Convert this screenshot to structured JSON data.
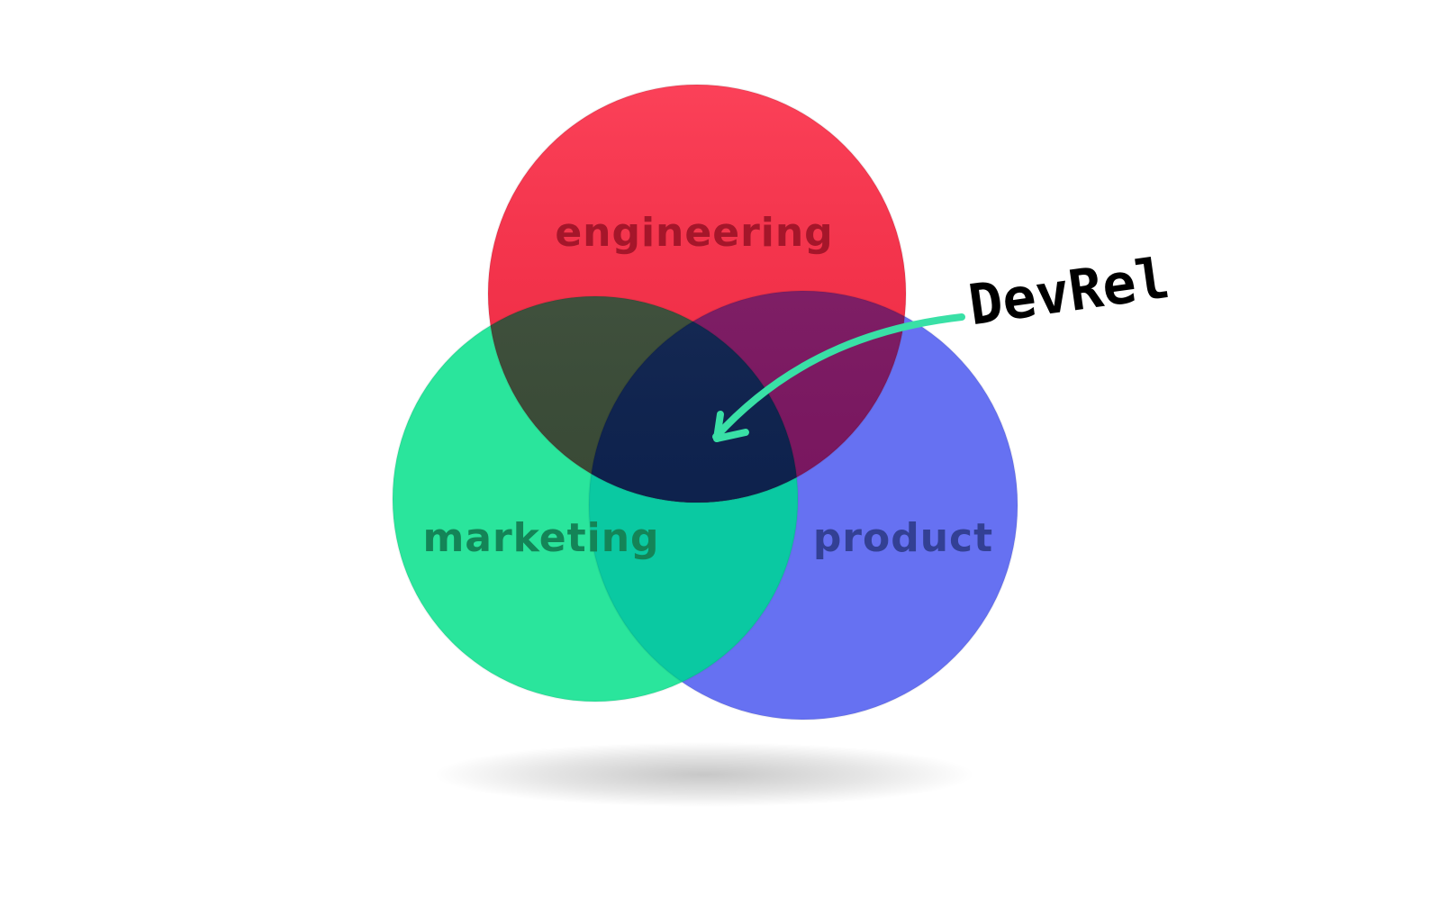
{
  "diagram": {
    "sets": [
      {
        "id": "engineering",
        "label": "engineering",
        "color": "#fb2c46",
        "label_color": "#a5162a"
      },
      {
        "id": "marketing",
        "label": "marketing",
        "color": "#2ae59c",
        "label_color": "#148457"
      },
      {
        "id": "product",
        "label": "product",
        "color": "#6671f2",
        "label_color": "#334094"
      }
    ],
    "intersections": {
      "engineering_marketing": "#3b4d38",
      "engineering_product": "#7e1763",
      "marketing_product": "#0ac9a2",
      "all_three": "#0e2350"
    },
    "callout": {
      "label": "DevRel",
      "label_color": "#000000",
      "arrow_color": "#39e0a6"
    }
  }
}
